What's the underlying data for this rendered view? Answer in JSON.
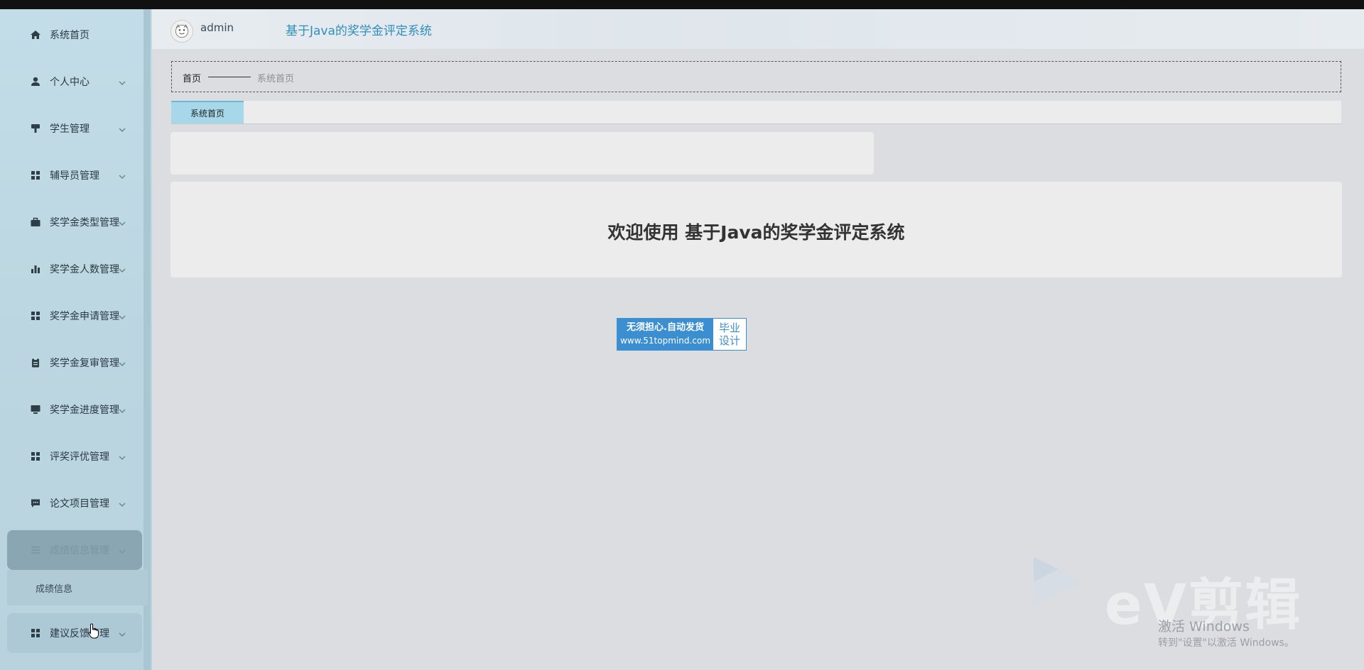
{
  "sidebar": {
    "items": [
      {
        "label": "系统首页",
        "icon": "home-icon",
        "has_chevron": false
      },
      {
        "label": "个人中心",
        "icon": "user-icon",
        "has_chevron": true
      },
      {
        "label": "学生管理",
        "icon": "student-icon",
        "has_chevron": true
      },
      {
        "label": "辅导员管理",
        "icon": "grid-icon",
        "has_chevron": true
      },
      {
        "label": "奖学金类型管理",
        "icon": "briefcase-icon",
        "has_chevron": true
      },
      {
        "label": "奖学金人数管理",
        "icon": "bar-chart-icon",
        "has_chevron": true
      },
      {
        "label": "奖学金申请管理",
        "icon": "grid-icon",
        "has_chevron": true
      },
      {
        "label": "奖学金复审管理",
        "icon": "clipboard-icon",
        "has_chevron": true
      },
      {
        "label": "奖学金进度管理",
        "icon": "monitor-icon",
        "has_chevron": true
      },
      {
        "label": "评奖评优管理",
        "icon": "grid-icon",
        "has_chevron": true
      },
      {
        "label": "论文项目管理",
        "icon": "comment-icon",
        "has_chevron": true
      },
      {
        "label": "成绩信息管理",
        "icon": "list-icon",
        "has_chevron": true
      },
      {
        "label": "建议反馈管理",
        "icon": "grid-icon",
        "has_chevron": true
      }
    ],
    "submenu": {
      "label": "成绩信息"
    }
  },
  "header": {
    "username": "admin",
    "app_title": "基于Java的奖学金评定系统"
  },
  "breadcrumb": {
    "home": "首页",
    "current": "系统首页"
  },
  "tabs": [
    {
      "label": "系统首页",
      "active": true
    }
  ],
  "welcome": {
    "text": "欢迎使用 基于Java的奖学金评定系统"
  },
  "badge": {
    "line1": "无须担心.自动发货",
    "line2": "www.51topmind.com",
    "right1": "毕业",
    "right2": "设计"
  },
  "watermark": {
    "brand": "eV剪辑"
  },
  "os_notice": {
    "title": "激活 Windows",
    "subtitle": "转到\"设置\"以激活 Windows。"
  },
  "colors": {
    "sidebar_bg": "#c3dde8",
    "accent": "#2f8fbc",
    "tab_active": "#a7d8ea",
    "badge_blue": "#3b8fd1"
  }
}
